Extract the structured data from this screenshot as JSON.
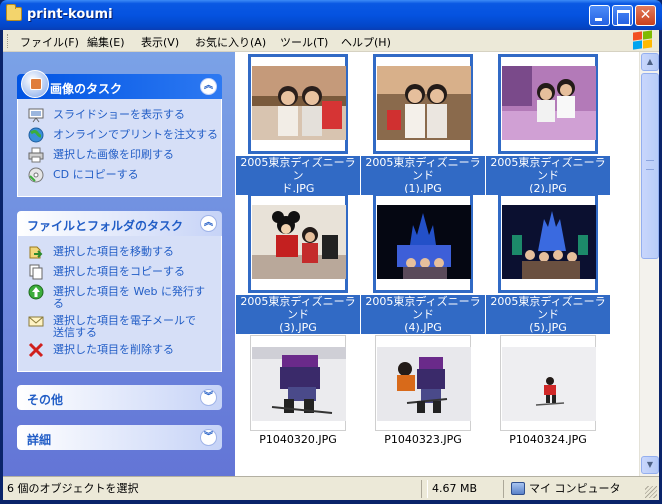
{
  "window": {
    "title": "print-koumi"
  },
  "menu": [
    "ファイル(F)",
    "編集(E)",
    "表示(V)",
    "お気に入り(A)",
    "ツール(T)",
    "ヘルプ(H)"
  ],
  "colors": {
    "title_bar": "#0553e0",
    "task_pane": "#6f8ee0",
    "selection": "#316ac5",
    "task_text": "#215dc6"
  },
  "image_tasks": {
    "title": "画像のタスク",
    "items": [
      {
        "label": "スライドショーを表示する",
        "icon": "slideshow-icon"
      },
      {
        "label": "オンラインでプリントを注文する",
        "icon": "globe-icon"
      },
      {
        "label": "選択した画像を印刷する",
        "icon": "printer-icon"
      },
      {
        "label": "CD にコピーする",
        "icon": "cd-icon"
      }
    ]
  },
  "file_tasks": {
    "title": "ファイルとフォルダのタスク",
    "items": [
      {
        "label": "選択した項目を移動する",
        "icon": "move-icon"
      },
      {
        "label": "選択した項目をコピーする",
        "icon": "copy-icon"
      },
      {
        "label_l1": "選択した項目を Web に発行す",
        "label_l2": "る",
        "icon": "publish-web-icon"
      },
      {
        "label_l1": "選択した項目を電子メールで",
        "label_l2": "送信する",
        "icon": "email-icon"
      },
      {
        "label": "選択した項目を削除する",
        "icon": "delete-icon"
      }
    ]
  },
  "other_panel": {
    "title": "その他"
  },
  "details_panel": {
    "title": "詳細"
  },
  "files": [
    {
      "l1": "2005東京ディズニーラン",
      "l2": "ド.JPG",
      "selected": true
    },
    {
      "l1": "2005東京ディズニーランド",
      "l2": "(1).JPG",
      "selected": true
    },
    {
      "l1": "2005東京ディズニーランド",
      "l2": "(2).JPG",
      "selected": true
    },
    {
      "l1": "2005東京ディズニーランド",
      "l2": "(3).JPG",
      "selected": true
    },
    {
      "l1": "2005東京ディズニーランド",
      "l2": "(4).JPG",
      "selected": true
    },
    {
      "l1": "2005東京ディズニーランド",
      "l2": "(5).JPG",
      "selected": true
    },
    {
      "l1": "P1040320.JPG",
      "l2": "",
      "selected": false
    },
    {
      "l1": "P1040323.JPG",
      "l2": "",
      "selected": false
    },
    {
      "l1": "P1040324.JPG",
      "l2": "",
      "selected": false
    }
  ],
  "status": {
    "selection": "6 個のオブジェクトを選択",
    "size": "4.67 MB",
    "location": "マイ コンピュータ"
  }
}
